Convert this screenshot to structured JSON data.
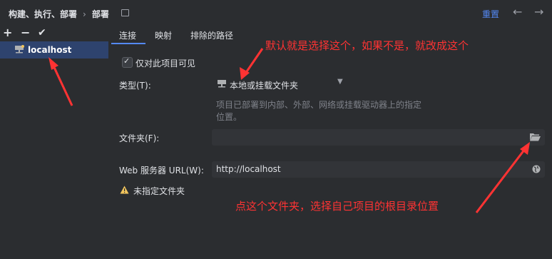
{
  "header": {
    "breadcrumb_parent": "构建、执行、部署",
    "breadcrumb_separator": "›",
    "breadcrumb_current": "部署",
    "reset_label": "重置",
    "back_icon": "arrow-left-icon",
    "forward_icon": "arrow-right-icon"
  },
  "toolbar": {
    "add_symbol": "+",
    "remove_symbol": "−",
    "confirm_symbol": "✔"
  },
  "servers": [
    {
      "label": "localhost",
      "selected": true,
      "icon": "server-icon"
    }
  ],
  "tabs": [
    {
      "label": "连接",
      "active": true
    },
    {
      "label": "映射",
      "active": false
    },
    {
      "label": "排除的路径",
      "active": false
    }
  ],
  "form": {
    "visible_only_label": "仅对此项目可见",
    "visible_only_checked": true,
    "type_label": "类型(T):",
    "type_value": "本地或挂载文件夹",
    "type_hint": "项目已部署到内部、外部、网络或挂载驱动器上的指定位置。",
    "folder_label": "文件夹(F):",
    "folder_value": "",
    "url_label": "Web 服务器 URL(W):",
    "url_value": "http://localhost",
    "warning_text": "未指定文件夹"
  },
  "annotations": {
    "top_note": "默认就是选择这个，如果不是，就改成这个",
    "bottom_note": "点这个文件夹，选择自己项目的根目录位置",
    "color": "#ff3333"
  },
  "colors": {
    "background": "#2b2d30",
    "accent": "#548af7",
    "selection": "#2e436e",
    "warning": "#f2c55c"
  }
}
